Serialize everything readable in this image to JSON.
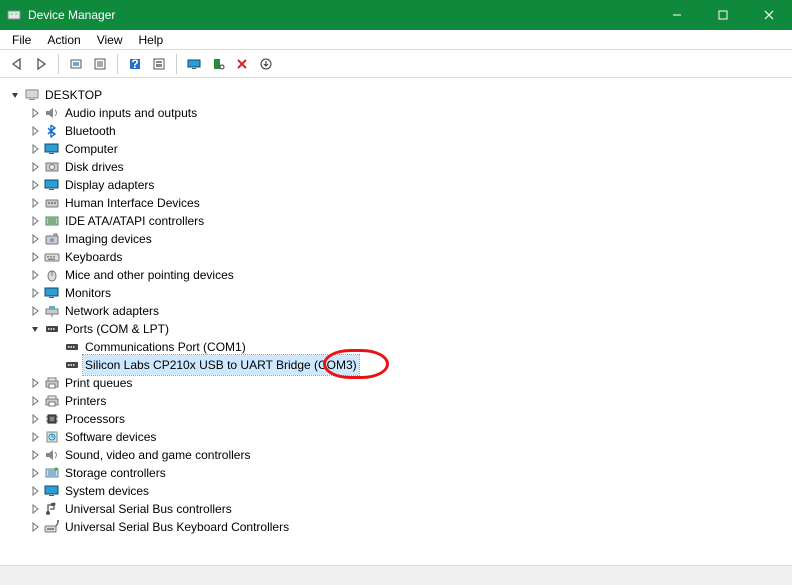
{
  "titlebar": {
    "title": "Device Manager"
  },
  "menubar": {
    "items": [
      "File",
      "Action",
      "View",
      "Help"
    ]
  },
  "toolbar": {
    "buttons": [
      "back",
      "forward",
      "|",
      "show-hidden",
      "properties",
      "|",
      "help",
      "update",
      "|",
      "monitor",
      "scan",
      "uninstall",
      "action"
    ]
  },
  "tree": {
    "root": {
      "expanded": true,
      "label": "DESKTOP",
      "icon": "computer"
    },
    "children": [
      {
        "label": "Audio inputs and outputs",
        "icon": "audio",
        "expanded": false
      },
      {
        "label": "Bluetooth",
        "icon": "bluetooth",
        "expanded": false
      },
      {
        "label": "Computer",
        "icon": "monitor-blue",
        "expanded": false
      },
      {
        "label": "Disk drives",
        "icon": "disk",
        "expanded": false
      },
      {
        "label": "Display adapters",
        "icon": "monitor-blue",
        "expanded": false
      },
      {
        "label": "Human Interface Devices",
        "icon": "hid",
        "expanded": false
      },
      {
        "label": "IDE ATA/ATAPI controllers",
        "icon": "ide",
        "expanded": false
      },
      {
        "label": "Imaging devices",
        "icon": "camera",
        "expanded": false
      },
      {
        "label": "Keyboards",
        "icon": "keyboard",
        "expanded": false
      },
      {
        "label": "Mice and other pointing devices",
        "icon": "mouse",
        "expanded": false
      },
      {
        "label": "Monitors",
        "icon": "monitor-blue",
        "expanded": false
      },
      {
        "label": "Network adapters",
        "icon": "network",
        "expanded": false
      },
      {
        "label": "Ports (COM & LPT)",
        "icon": "port",
        "expanded": true,
        "children": [
          {
            "label": "Communications Port (COM1)",
            "icon": "port"
          },
          {
            "label": "Silicon Labs CP210x USB to UART Bridge (COM3)",
            "icon": "port",
            "selected": true
          }
        ]
      },
      {
        "label": "Print queues",
        "icon": "printer",
        "expanded": false
      },
      {
        "label": "Printers",
        "icon": "printer",
        "expanded": false
      },
      {
        "label": "Processors",
        "icon": "cpu",
        "expanded": false
      },
      {
        "label": "Software devices",
        "icon": "software",
        "expanded": false
      },
      {
        "label": "Sound, video and game controllers",
        "icon": "audio",
        "expanded": false
      },
      {
        "label": "Storage controllers",
        "icon": "storage",
        "expanded": false
      },
      {
        "label": "System devices",
        "icon": "monitor-blue",
        "expanded": false
      },
      {
        "label": "Universal Serial Bus controllers",
        "icon": "usb",
        "expanded": false
      },
      {
        "label": "Universal Serial Bus Keyboard Controllers",
        "icon": "usb-keyboard",
        "expanded": false
      }
    ]
  },
  "annotation": {
    "target": "(COM3)"
  }
}
